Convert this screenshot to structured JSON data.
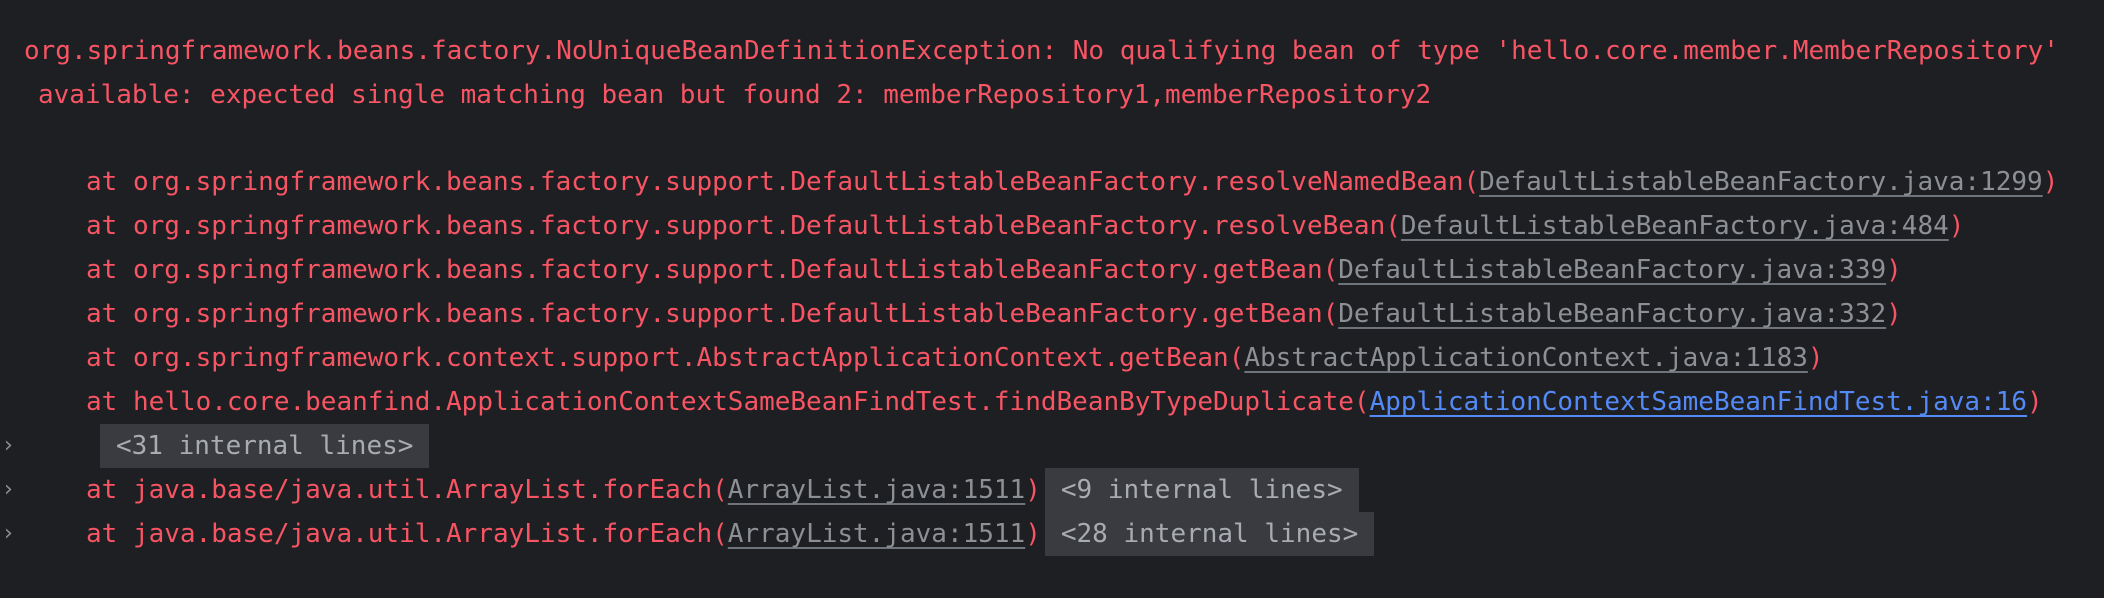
{
  "exception": {
    "line1": "org.springframework.beans.factory.NoUniqueBeanDefinitionException: No qualifying bean of type 'hello.core.member.MemberRepository'",
    "line2": "available: expected single matching bean but found 2: memberRepository1,memberRepository2"
  },
  "stack": [
    {
      "prefix": "at org.springframework.beans.factory.support.DefaultListableBeanFactory.resolveNamedBean(",
      "link": "DefaultListableBeanFactory.java:1299",
      "suffix": ")"
    },
    {
      "prefix": "at org.springframework.beans.factory.support.DefaultListableBeanFactory.resolveBean(",
      "link": "DefaultListableBeanFactory.java:484",
      "suffix": ")"
    },
    {
      "prefix": "at org.springframework.beans.factory.support.DefaultListableBeanFactory.getBean(",
      "link": "DefaultListableBeanFactory.java:339",
      "suffix": ")"
    },
    {
      "prefix": "at org.springframework.beans.factory.support.DefaultListableBeanFactory.getBean(",
      "link": "DefaultListableBeanFactory.java:332",
      "suffix": ")"
    },
    {
      "prefix": "at org.springframework.context.support.AbstractApplicationContext.getBean(",
      "link": "AbstractApplicationContext.java:1183",
      "suffix": ")"
    },
    {
      "prefix": "at hello.core.beanfind.ApplicationContextSameBeanFindTest.findBeanByTypeDuplicate(",
      "link": "ApplicationContextSameBeanFindTest.java:16",
      "suffix": ")"
    }
  ],
  "folds": {
    "internal_31": "<31 internal lines>",
    "arraylist_1": {
      "prefix": "at java.base/java.util.ArrayList.forEach(",
      "link": "ArrayList.java:1511",
      "suffix": ")",
      "fold": "<9 internal lines>"
    },
    "arraylist_2": {
      "prefix": "at java.base/java.util.ArrayList.forEach(",
      "link": "ArrayList.java:1511",
      "suffix": ")",
      "fold": "<28 internal lines>"
    }
  },
  "colors": {
    "background": "#1e1f22",
    "error_text": "#f75464",
    "grey_link": "#8c8f94",
    "blue_link": "#548af7",
    "fold_bg": "#393b40"
  },
  "icons": {
    "expand": "chevron-right-icon"
  }
}
